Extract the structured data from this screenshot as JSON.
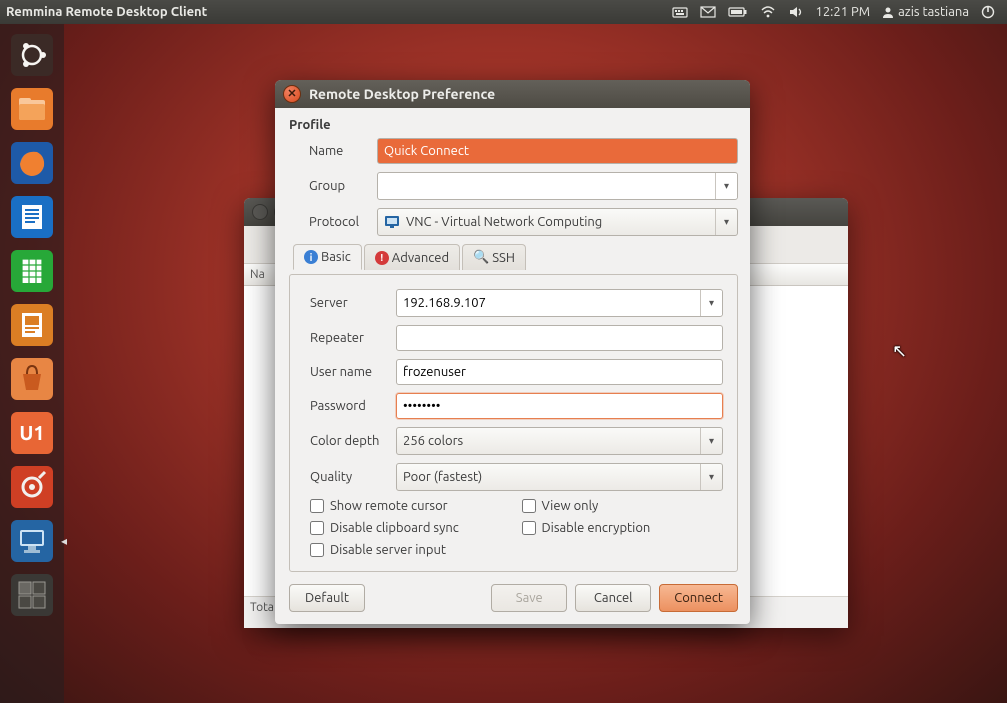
{
  "panel": {
    "app_title": "Remmina Remote Desktop Client",
    "time": "12:21 PM",
    "user": "azis tastiana"
  },
  "launcher": {
    "items": [
      {
        "name": "dash",
        "color1": "#4a342f",
        "color2": "#2e1f1b"
      },
      {
        "name": "files",
        "color1": "#f58b3c",
        "color2": "#e06a1e"
      },
      {
        "name": "firefox",
        "color1": "#2a62b4",
        "color2": "#163f7e"
      },
      {
        "name": "writer",
        "color1": "#1f72c9",
        "color2": "#0e4b91"
      },
      {
        "name": "calc",
        "color1": "#32b742",
        "color2": "#1b8a27"
      },
      {
        "name": "impress",
        "color1": "#e78a2e",
        "color2": "#c96a14"
      },
      {
        "name": "software-center",
        "color1": "#ec8b4a",
        "color2": "#d56a25"
      },
      {
        "name": "ubuntu-one",
        "color1": "#ef6e3a",
        "color2": "#d84e1a"
      },
      {
        "name": "settings",
        "color1": "#d9472a",
        "color2": "#b23016"
      },
      {
        "name": "remmina",
        "color1": "#2a6fb0",
        "color2": "#184d81",
        "arrow": true
      },
      {
        "name": "workspace",
        "color1": "#42403d",
        "color2": "#2a2926"
      }
    ]
  },
  "bg_window": {
    "col_name": "Na",
    "status": "Tota"
  },
  "dialog": {
    "title": "Remote Desktop Preference",
    "profile_heading": "Profile",
    "labels": {
      "name": "Name",
      "group": "Group",
      "protocol": "Protocol",
      "server": "Server",
      "repeater": "Repeater",
      "username": "User name",
      "password": "Password",
      "color_depth": "Color depth",
      "quality": "Quality"
    },
    "values": {
      "name": "Quick Connect",
      "group": "",
      "protocol": "VNC - Virtual Network Computing",
      "server": "192.168.9.107",
      "repeater": "",
      "username": "frozenuser",
      "password": "••••••••",
      "color_depth": "256 colors",
      "quality": "Poor (fastest)"
    },
    "tabs": {
      "basic": "Basic",
      "advanced": "Advanced",
      "ssh": "SSH"
    },
    "checkboxes": {
      "show_remote_cursor": "Show remote cursor",
      "view_only": "View only",
      "disable_clipboard": "Disable clipboard sync",
      "disable_encryption": "Disable encryption",
      "disable_server_input": "Disable server input"
    },
    "buttons": {
      "default": "Default",
      "save": "Save",
      "cancel": "Cancel",
      "connect": "Connect"
    }
  }
}
